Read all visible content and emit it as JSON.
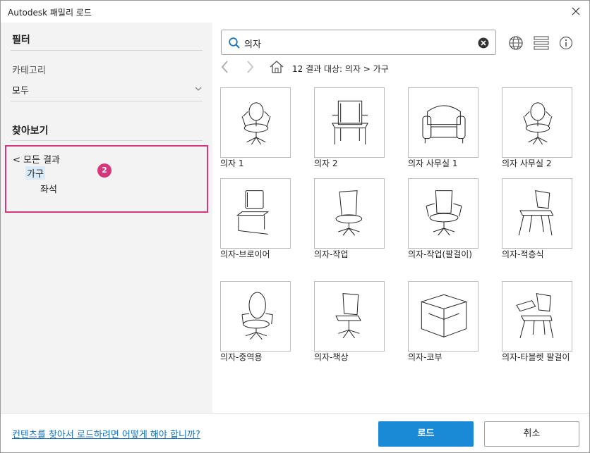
{
  "window": {
    "title": "Autodesk 패밀리 로드",
    "close_icon": "close-icon"
  },
  "filter": {
    "title": "필터",
    "category_label": "카테고리",
    "category_value": "모두"
  },
  "browse": {
    "title": "찾아보기",
    "back_label": "< 모든 결과",
    "items": [
      "가구",
      "좌석"
    ],
    "badge": "2",
    "accent_color": "#d6367a"
  },
  "search": {
    "value": "의자",
    "placeholder": ""
  },
  "breadcrumb": {
    "text": "12 결과 대상: 의자 > 가구"
  },
  "results": [
    {
      "label": "의자 1",
      "icon": "office-chair-icon"
    },
    {
      "label": "의자 2",
      "icon": "armchair-icon"
    },
    {
      "label": "의자 사무실 1",
      "icon": "sofa-chair-icon"
    },
    {
      "label": "의자 사무실 2",
      "icon": "office-chair-icon"
    },
    {
      "label": "의자-브로이어",
      "icon": "cantilever-chair-icon"
    },
    {
      "label": "의자-작업",
      "icon": "task-chair-icon"
    },
    {
      "label": "의자-작업(팔걸이)",
      "icon": "task-chair-arms-icon"
    },
    {
      "label": "의자-적층식",
      "icon": "stacking-chair-icon"
    },
    {
      "label": "의자-중역용",
      "icon": "executive-chair-icon"
    },
    {
      "label": "의자-책상",
      "icon": "desk-chair-icon"
    },
    {
      "label": "의자-코부",
      "icon": "cube-chair-icon"
    },
    {
      "label": "의자-타블렛 팔걸이",
      "icon": "tablet-arm-chair-icon"
    }
  ],
  "footer": {
    "help_link": "컨텐츠를 찾아서 로드하려면 어떻게 해야 합니까?",
    "load_label": "로드",
    "cancel_label": "취소"
  },
  "colors": {
    "primary": "#1a8ad6",
    "link": "#1a73b8",
    "left_panel": "#f3f3f3"
  }
}
